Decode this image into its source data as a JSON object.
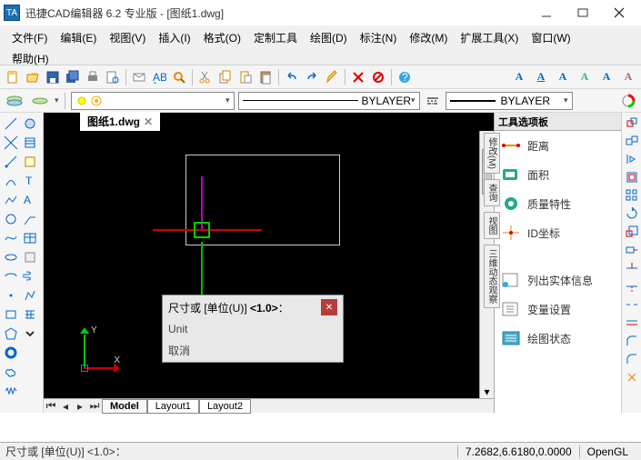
{
  "title": "迅捷CAD编辑器 6.2 专业版  - [图纸1.dwg]",
  "appicon_text": "TA",
  "menu": {
    "file": "文件(F)",
    "edit": "编辑(E)",
    "view": "视图(V)",
    "insert": "插入(I)",
    "format": "格式(O)",
    "tools": "定制工具",
    "draw": "绘图(D)",
    "dim": "标注(N)",
    "modify": "修改(M)",
    "ext": "扩展工具(X)",
    "window": "窗口(W)",
    "help": "帮助(H)"
  },
  "file_tab": "图纸1.dwg",
  "line_combo": {
    "label": "BYLAYER"
  },
  "weight_combo": {
    "label": "BYLAYER"
  },
  "cmd_popup": {
    "prompt_prefix": "尺寸或 [单位(U)] ",
    "prompt_default": "<1.0>",
    "prompt_suffix": "：",
    "opt1": "Unit",
    "opt2": "取消"
  },
  "model_tabs": {
    "model": "Model",
    "l1": "Layout1",
    "l2": "Layout2"
  },
  "right_panel": {
    "title": "工具选项板",
    "items": [
      {
        "label": "距离",
        "icon": "distance"
      },
      {
        "label": "面积",
        "icon": "area"
      },
      {
        "label": "质量特性",
        "icon": "massprops"
      },
      {
        "label": "ID坐标",
        "icon": "idpoint"
      },
      {
        "label": "列出实体信息",
        "icon": "list"
      },
      {
        "label": "变量设置",
        "icon": "setvar"
      },
      {
        "label": "绘图状态",
        "icon": "status"
      }
    ]
  },
  "vtabs": {
    "modify": "修改(M)",
    "inquiry": "查询",
    "view": "视图",
    "obs": "三维动态观察"
  },
  "ucs": {
    "x": "X",
    "y": "Y"
  },
  "status": {
    "prompt": "尺寸或 [单位(U)] <1.0>：",
    "coord": "7.2682,6.6180,0.0000",
    "renderer": "OpenGL"
  },
  "font_buttons": [
    "A",
    "A",
    "A",
    "A",
    "A",
    "A"
  ]
}
